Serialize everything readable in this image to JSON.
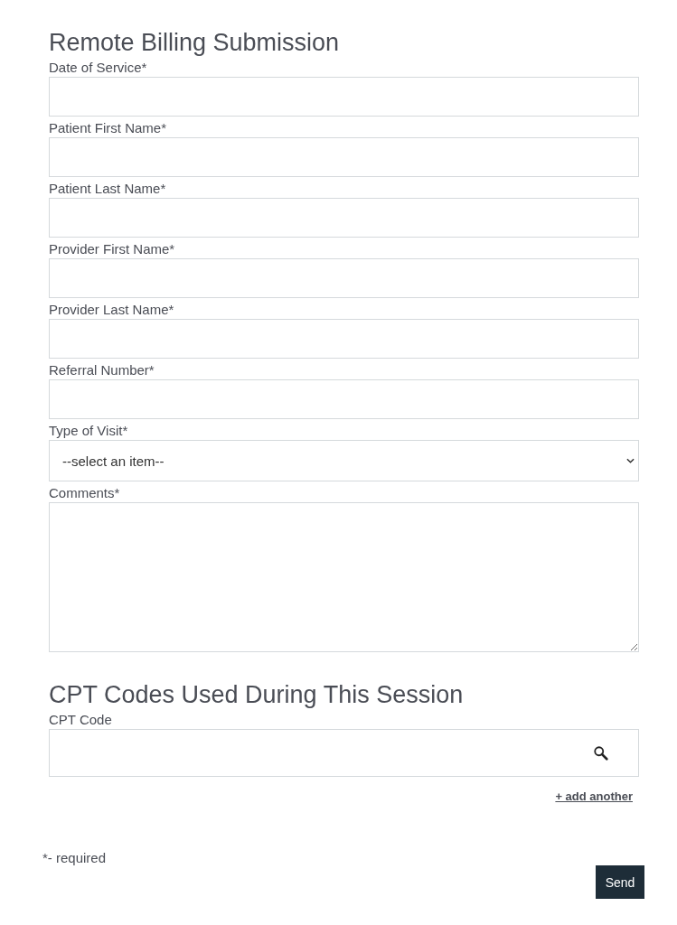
{
  "title": "Remote Billing Submission",
  "fields": [
    {
      "kind": "input",
      "label": "Date of Service*"
    },
    {
      "kind": "input",
      "label": "Patient First Name*"
    },
    {
      "kind": "input",
      "label": "Patient Last Name*"
    },
    {
      "kind": "input",
      "label": "Provider First Name*"
    },
    {
      "kind": "input",
      "label": "Provider Last Name*"
    },
    {
      "kind": "input",
      "label": "Referral Number*"
    },
    {
      "kind": "select",
      "label": "Type of Visit*",
      "value": "--select an item--"
    },
    {
      "kind": "textarea",
      "label": "Comments*"
    }
  ],
  "cpt_section": {
    "title": "CPT Codes Used During This Session",
    "label": "CPT Code",
    "add_link": "+ add another"
  },
  "required_note": "*- required",
  "send_button": "Send"
}
